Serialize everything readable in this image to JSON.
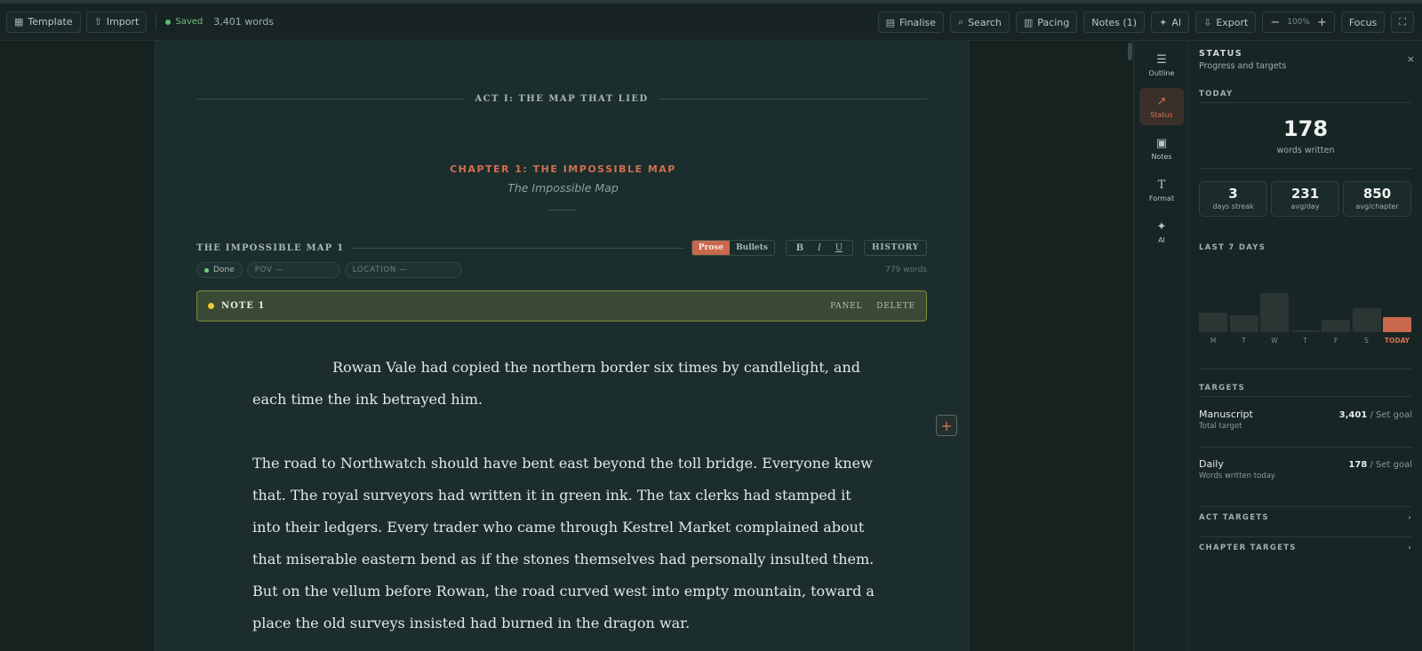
{
  "toolbar": {
    "template": "Template",
    "import": "Import",
    "saved": "Saved",
    "word_count": "3,401 words",
    "finalise": "Finalise",
    "search": "Search",
    "pacing": "Pacing",
    "notes": "Notes (1)",
    "ai": "AI",
    "export": "Export",
    "zoom_minus": "−",
    "zoom_level": "100%",
    "zoom_plus": "+",
    "focus": "Focus"
  },
  "editor": {
    "act_title": "ACT I: THE MAP THAT LIED",
    "chapter_title": "CHAPTER 1: THE IMPOSSIBLE MAP",
    "chapter_subtitle": "The Impossible Map",
    "scene_title": "THE IMPOSSIBLE MAP 1",
    "mode_prose": "Prose",
    "mode_bullets": "Bullets",
    "fmt_bold": "B",
    "fmt_italic": "I",
    "fmt_underline": "U",
    "history": "HISTORY",
    "status_pill": "Done",
    "pov_placeholder": "POV —",
    "location_placeholder": "LOCATION —",
    "scene_words": "779 words",
    "note_title": "NOTE 1",
    "note_panel": "PANEL",
    "note_delete": "DELETE",
    "paragraph1": "Rowan Vale had copied the northern border six times by candlelight, and each time the ink betrayed him.",
    "paragraph2": "The road to Northwatch should have bent east beyond the toll bridge. Everyone knew that. The royal surveyors had written it in green ink. The tax clerks had stamped it into their ledgers. Every trader who came through Kestrel Market complained about that miserable eastern bend as if the stones themselves had personally insulted them. But on the vellum before Rowan, the road curved west into empty mountain, toward a place the old surveys insisted had burned in the dragon war.",
    "add_block": "+"
  },
  "rail": {
    "outline": "Outline",
    "status": "Status",
    "notes": "Notes",
    "format": "Format",
    "ai": "AI"
  },
  "status_panel": {
    "title": "STATUS",
    "subtitle": "Progress and targets",
    "close": "×",
    "today_label": "TODAY",
    "today_words": "178",
    "today_words_label": "words written",
    "stats": [
      {
        "value": "3",
        "label": "days streak"
      },
      {
        "value": "231",
        "label": "avg/day"
      },
      {
        "value": "850",
        "label": "avg/chapter"
      }
    ],
    "last7_label": "LAST 7 DAYS",
    "last7": [
      {
        "day": "M",
        "value": 0.5
      },
      {
        "day": "T",
        "value": 0.43
      },
      {
        "day": "W",
        "value": 1.0
      },
      {
        "day": "T",
        "value": 0.05
      },
      {
        "day": "F",
        "value": 0.31
      },
      {
        "day": "S",
        "value": 0.62
      },
      {
        "day": "TODAY",
        "value": 0.38
      }
    ],
    "targets_label": "TARGETS",
    "manuscript_name": "Manuscript",
    "manuscript_sub": "Total target",
    "manuscript_value": "3,401",
    "manuscript_sep": " / ",
    "manuscript_goal": "Set goal",
    "daily_name": "Daily",
    "daily_sub": "Words written today",
    "daily_value": "178",
    "daily_sep": " / ",
    "daily_goal": "Set goal",
    "act_targets": "ACT TARGETS",
    "chapter_targets": "CHAPTER TARGETS",
    "chevron": "›"
  },
  "colors": {
    "accent": "#c9684c",
    "saved_green": "#5fbf6c",
    "note_dot": "#f0c93a"
  }
}
